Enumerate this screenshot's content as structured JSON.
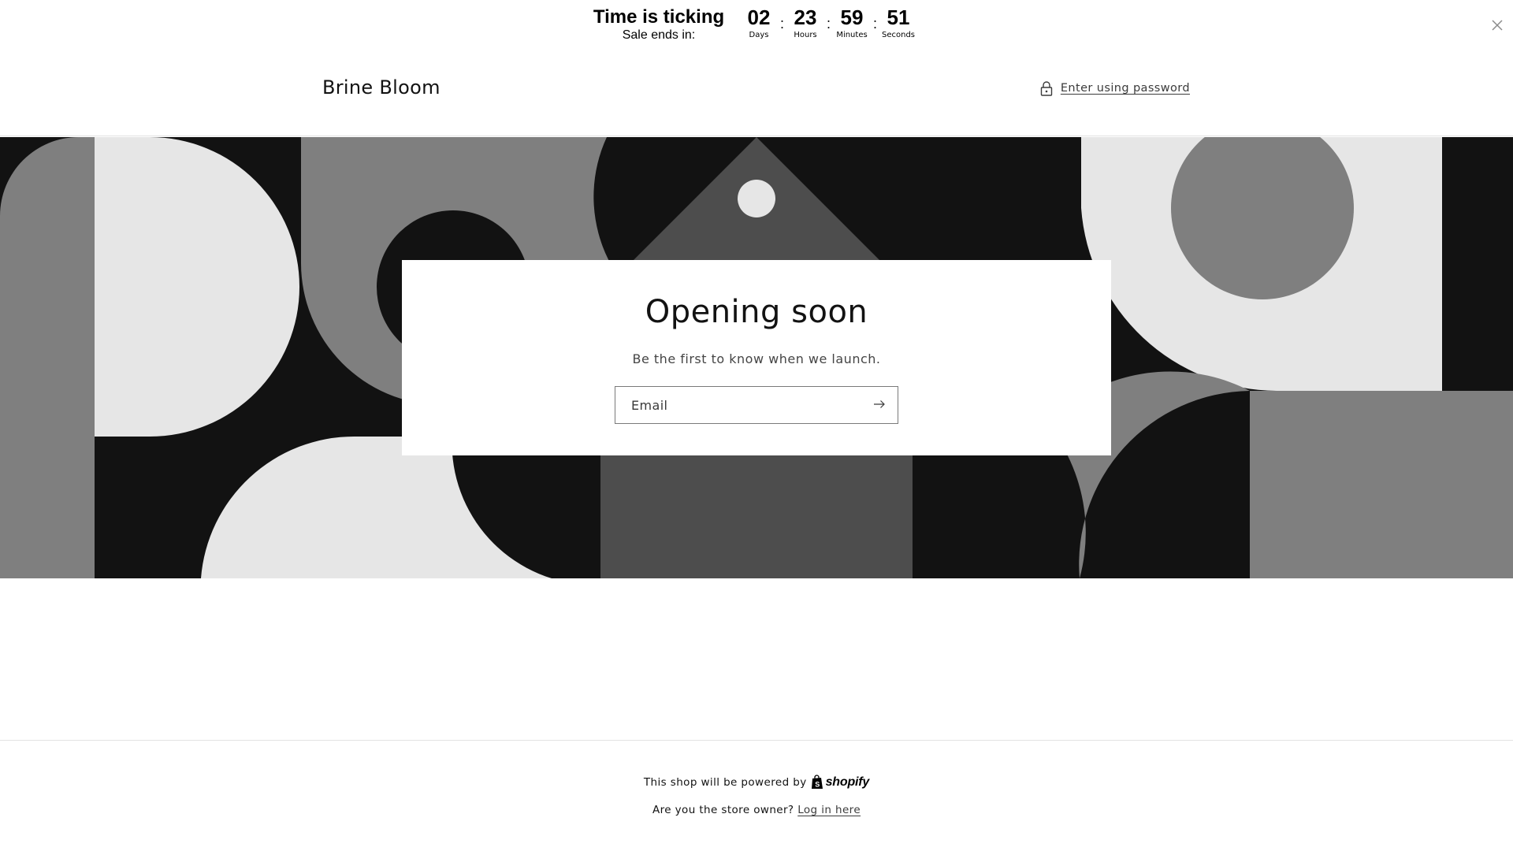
{
  "countdown": {
    "title": "Time is ticking",
    "subtitle": "Sale ends in:",
    "units": [
      {
        "value": "02",
        "label": "Days"
      },
      {
        "value": "23",
        "label": "Hours"
      },
      {
        "value": "59",
        "label": "Minutes"
      },
      {
        "value": "51",
        "label": "Seconds"
      }
    ],
    "separator": ":",
    "close_icon": "close-icon"
  },
  "header": {
    "store_name": "Brine Bloom",
    "password_link": "Enter using password",
    "lock_icon": "lock-icon"
  },
  "newsletter": {
    "heading": "Opening soon",
    "text": "Be the first to know when we launch.",
    "email_placeholder": "Email",
    "submit_icon": "arrow-right-icon"
  },
  "footer": {
    "powered_text": "This shop will be powered by",
    "shopify_label": "shopify",
    "owner_text": "Are you the store owner?",
    "login_link": "Log in here"
  },
  "colors": {
    "black": "#121212",
    "dark_gray": "#4d4d4d",
    "mid_gray": "#7f7f7f",
    "light_gray": "#e6e6e6",
    "white": "#ffffff"
  }
}
